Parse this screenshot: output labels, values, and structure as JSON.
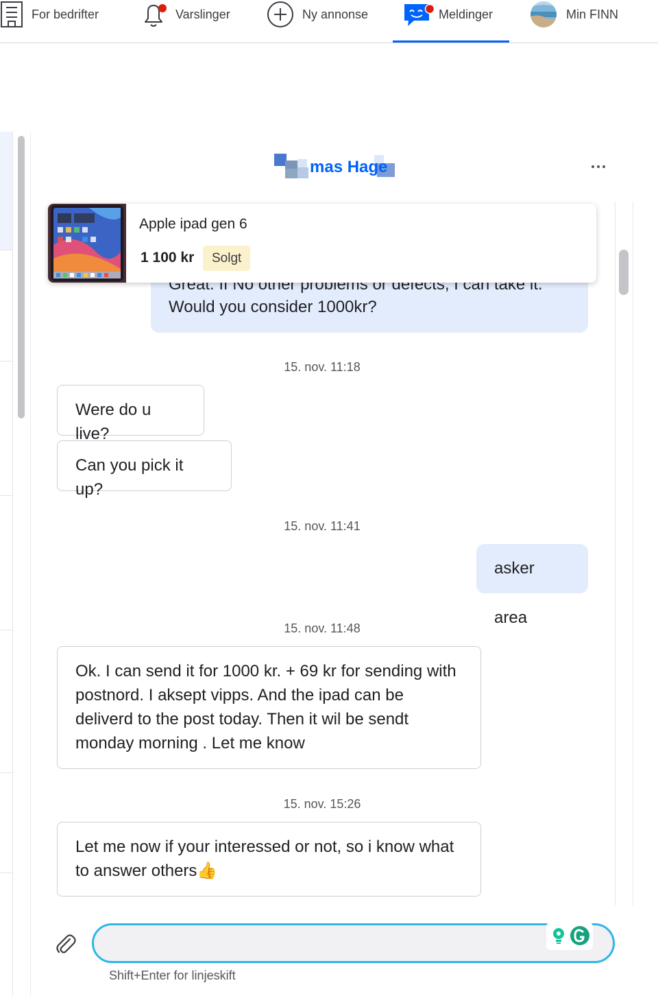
{
  "nav": {
    "for_business": "For bedrifter",
    "notifications": "Varslinger",
    "new_ad": "Ny annonse",
    "messages": "Meldinger",
    "my_finn": "Min FINN"
  },
  "conversation": {
    "partner_name": "mas Hage"
  },
  "ad": {
    "title": "Apple ipad gen 6",
    "price": "1 100 kr",
    "status": "Solgt"
  },
  "messages": [
    {
      "direction": "out",
      "text_partial": "Great. If No other problems or defects, I can take it.",
      "text": "Would you consider 1000kr?"
    },
    {
      "timestamp": "15. nov. 11:18"
    },
    {
      "direction": "in",
      "text": "Were do u live?"
    },
    {
      "direction": "in",
      "text": "Can you pick it up?"
    },
    {
      "timestamp": "15. nov. 11:41"
    },
    {
      "direction": "out",
      "text": "asker area"
    },
    {
      "timestamp": "15. nov. 11:48"
    },
    {
      "direction": "in",
      "text": "Ok. I can send it for 1000 kr. + 69 kr for sending with postnord. I aksept vipps. And the ipad can be deliverd to the post today. Then it wil be sendt monday morning . Let me know"
    },
    {
      "timestamp": "15. nov. 15:26"
    },
    {
      "direction": "in",
      "text": "Let me now if your interessed or not, so i know what to answer others👍"
    }
  ],
  "composer": {
    "value": "",
    "hint": "Shift+Enter for linjeskift"
  },
  "colors": {
    "brand_blue": "#0063fb",
    "outgoing_bubble": "#e3ecfd",
    "sold_badge": "#fcf1cd",
    "composer_border": "#2fb5e8",
    "notification_dot": "#d91f0a"
  }
}
